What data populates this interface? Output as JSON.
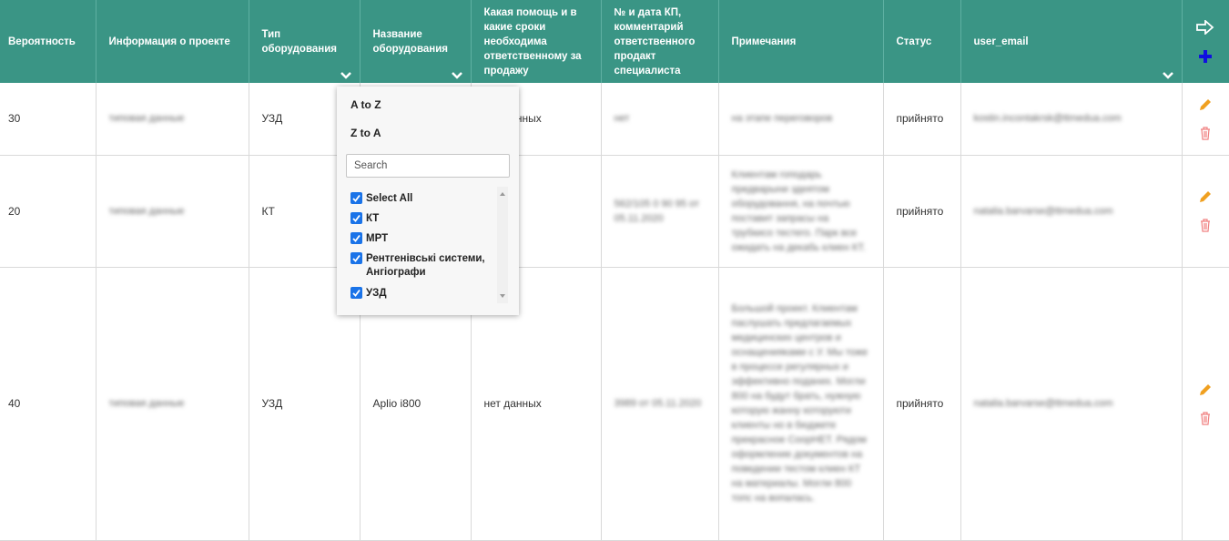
{
  "table": {
    "headers": {
      "probability": "Вероятность",
      "project_info": "Информация о проекте",
      "equipment_type": "Тип оборудования",
      "equipment_name": "Название оборудования",
      "help_needed": "Какая помощь и в какие сроки необходима ответственному за продажу",
      "kp_number": "№ и дата КП, комментарий ответственного продакт специалиста",
      "notes": "Примечания",
      "status": "Статус",
      "user_email": "user_email"
    },
    "rows": [
      {
        "probability": "30",
        "project_info": "типовая данные",
        "equipment_type": "УЗД",
        "equipment_name": "",
        "help_needed": "нет данных",
        "kp_number": "нет",
        "notes": "на этапе переговоров",
        "status": "прийнято",
        "user_email": "kostin.incontakrsk@ttmedua.com"
      },
      {
        "probability": "20",
        "project_info": "типовая данные",
        "equipment_type": "КТ",
        "equipment_name": "",
        "help_needed": "",
        "kp_number": "562/105 0 90 95 от 05.11.2020",
        "notes": "Клиентам гоподарь предварыни здеятом оборудовання, на почтью поставит запрасы на трубкисо тестего. Парк все ожидать на декабь клиен КТ.",
        "status": "прийнято",
        "user_email": "natalia.barvarse@ttmedua.com"
      },
      {
        "probability": "40",
        "project_info": "типовая данные",
        "equipment_type": "УЗД",
        "equipment_name": "Aplio i800",
        "help_needed": "нет данных",
        "kp_number": "3989 от 05.11.2020",
        "notes": "Большой проект. Клиентам паслушать предлагаемых медицинских центров и оснащенияками с У. Мы тоже в процессе регулярных и эффективно поданих. Могли 800 на будут брать, нужную которую жанну которуюти клиенты но в бюджете прекрасное СоорНЕТ. Рядом оформление документов на поведении тестом клиен КТ на материалы. Могли 800 топс на вопалась.",
        "status": "прийнято",
        "user_email": "natalia.barvarse@ttmedua.com"
      }
    ]
  },
  "filter_popup": {
    "sort_az": "A to Z",
    "sort_za": "Z to A",
    "search_placeholder": "Search",
    "options": [
      {
        "label": "Select All",
        "checked": true
      },
      {
        "label": "КТ",
        "checked": true
      },
      {
        "label": "МРТ",
        "checked": true
      },
      {
        "label": "Рентгенівські системи, Ангіографи",
        "checked": true
      },
      {
        "label": "УЗД",
        "checked": true
      }
    ]
  },
  "colors": {
    "header_bg": "#3a9585",
    "edit_icon": "#f0a020",
    "delete_icon": "#f08080",
    "add_icon": "#1010e0",
    "checkbox": "#1a73e8"
  },
  "icons": {
    "export": "export-arrow-icon",
    "add": "plus-icon",
    "edit": "pencil-icon",
    "delete": "trash-icon",
    "column_menu": "chevron-down-icon"
  }
}
